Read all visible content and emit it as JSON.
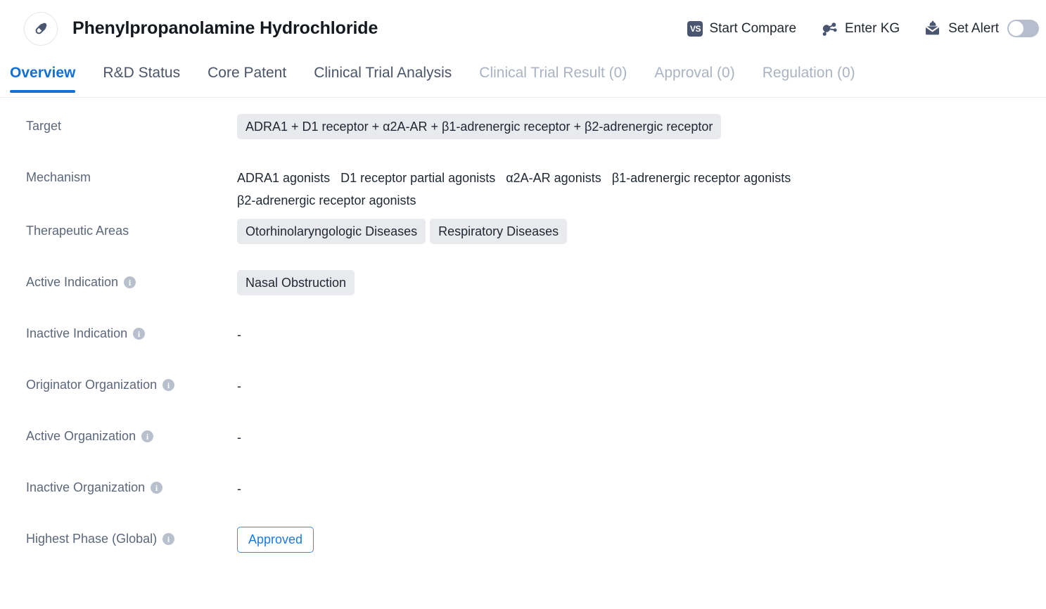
{
  "header": {
    "drug_icon": "capsule-icon",
    "title": "Phenylpropanolamine Hydrochloride",
    "actions": [
      {
        "id": "start-compare",
        "icon": "vs-compare-icon",
        "icon_text": "VS",
        "label": "Start Compare"
      },
      {
        "id": "enter-kg",
        "icon": "knowledge-graph-icon",
        "label": "Enter KG"
      },
      {
        "id": "set-alert",
        "icon": "alert-envelope-icon",
        "label": "Set Alert"
      }
    ],
    "alert_toggle": {
      "name": "set-alert-toggle",
      "state": "off"
    }
  },
  "tabs": [
    {
      "id": "overview",
      "label": "Overview",
      "active": true,
      "disabled": false
    },
    {
      "id": "rd-status",
      "label": "R&D Status",
      "active": false,
      "disabled": false
    },
    {
      "id": "core-patent",
      "label": "Core Patent",
      "active": false,
      "disabled": false
    },
    {
      "id": "clinical-trial-analysis",
      "label": "Clinical Trial Analysis",
      "active": false,
      "disabled": false
    },
    {
      "id": "clinical-trial-result",
      "label": "Clinical Trial Result (0)",
      "active": false,
      "disabled": true
    },
    {
      "id": "approval",
      "label": "Approval (0)",
      "active": false,
      "disabled": true
    },
    {
      "id": "regulation",
      "label": "Regulation (0)",
      "active": false,
      "disabled": true
    }
  ],
  "overview": {
    "target": {
      "label": "Target",
      "has_info": false,
      "chips": [
        "ADRA1 + D1 receptor + α2A-AR + β1-adrenergic receptor + β2-adrenergic receptor"
      ]
    },
    "mechanism": {
      "label": "Mechanism",
      "has_info": false,
      "items": [
        "ADRA1 agonists",
        "D1 receptor partial agonists",
        "α2A-AR agonists",
        "β1-adrenergic receptor agonists",
        "β2-adrenergic receptor agonists"
      ]
    },
    "therapeutic_areas": {
      "label": "Therapeutic Areas",
      "has_info": false,
      "chips": [
        "Otorhinolaryngologic Diseases",
        "Respiratory Diseases"
      ]
    },
    "active_indication": {
      "label": "Active Indication",
      "has_info": true,
      "chips": [
        "Nasal Obstruction"
      ]
    },
    "inactive_indication": {
      "label": "Inactive Indication",
      "has_info": true,
      "value": "-"
    },
    "originator_organization": {
      "label": "Originator Organization",
      "has_info": true,
      "value": "-"
    },
    "active_organization": {
      "label": "Active Organization",
      "has_info": true,
      "value": "-"
    },
    "inactive_organization": {
      "label": "Inactive Organization",
      "has_info": true,
      "value": "-"
    },
    "highest_phase": {
      "label": "Highest Phase (Global)",
      "has_info": true,
      "badge": "Approved"
    }
  },
  "colors": {
    "accent": "#1470d6",
    "badge_blue": "#1d7ae5",
    "icon_slate": "#4a5670",
    "chip_bg": "#e9eaee",
    "label_gray": "#5b677a",
    "disabled_tab": "#aab3c2"
  },
  "info_icon_glyph": "i"
}
